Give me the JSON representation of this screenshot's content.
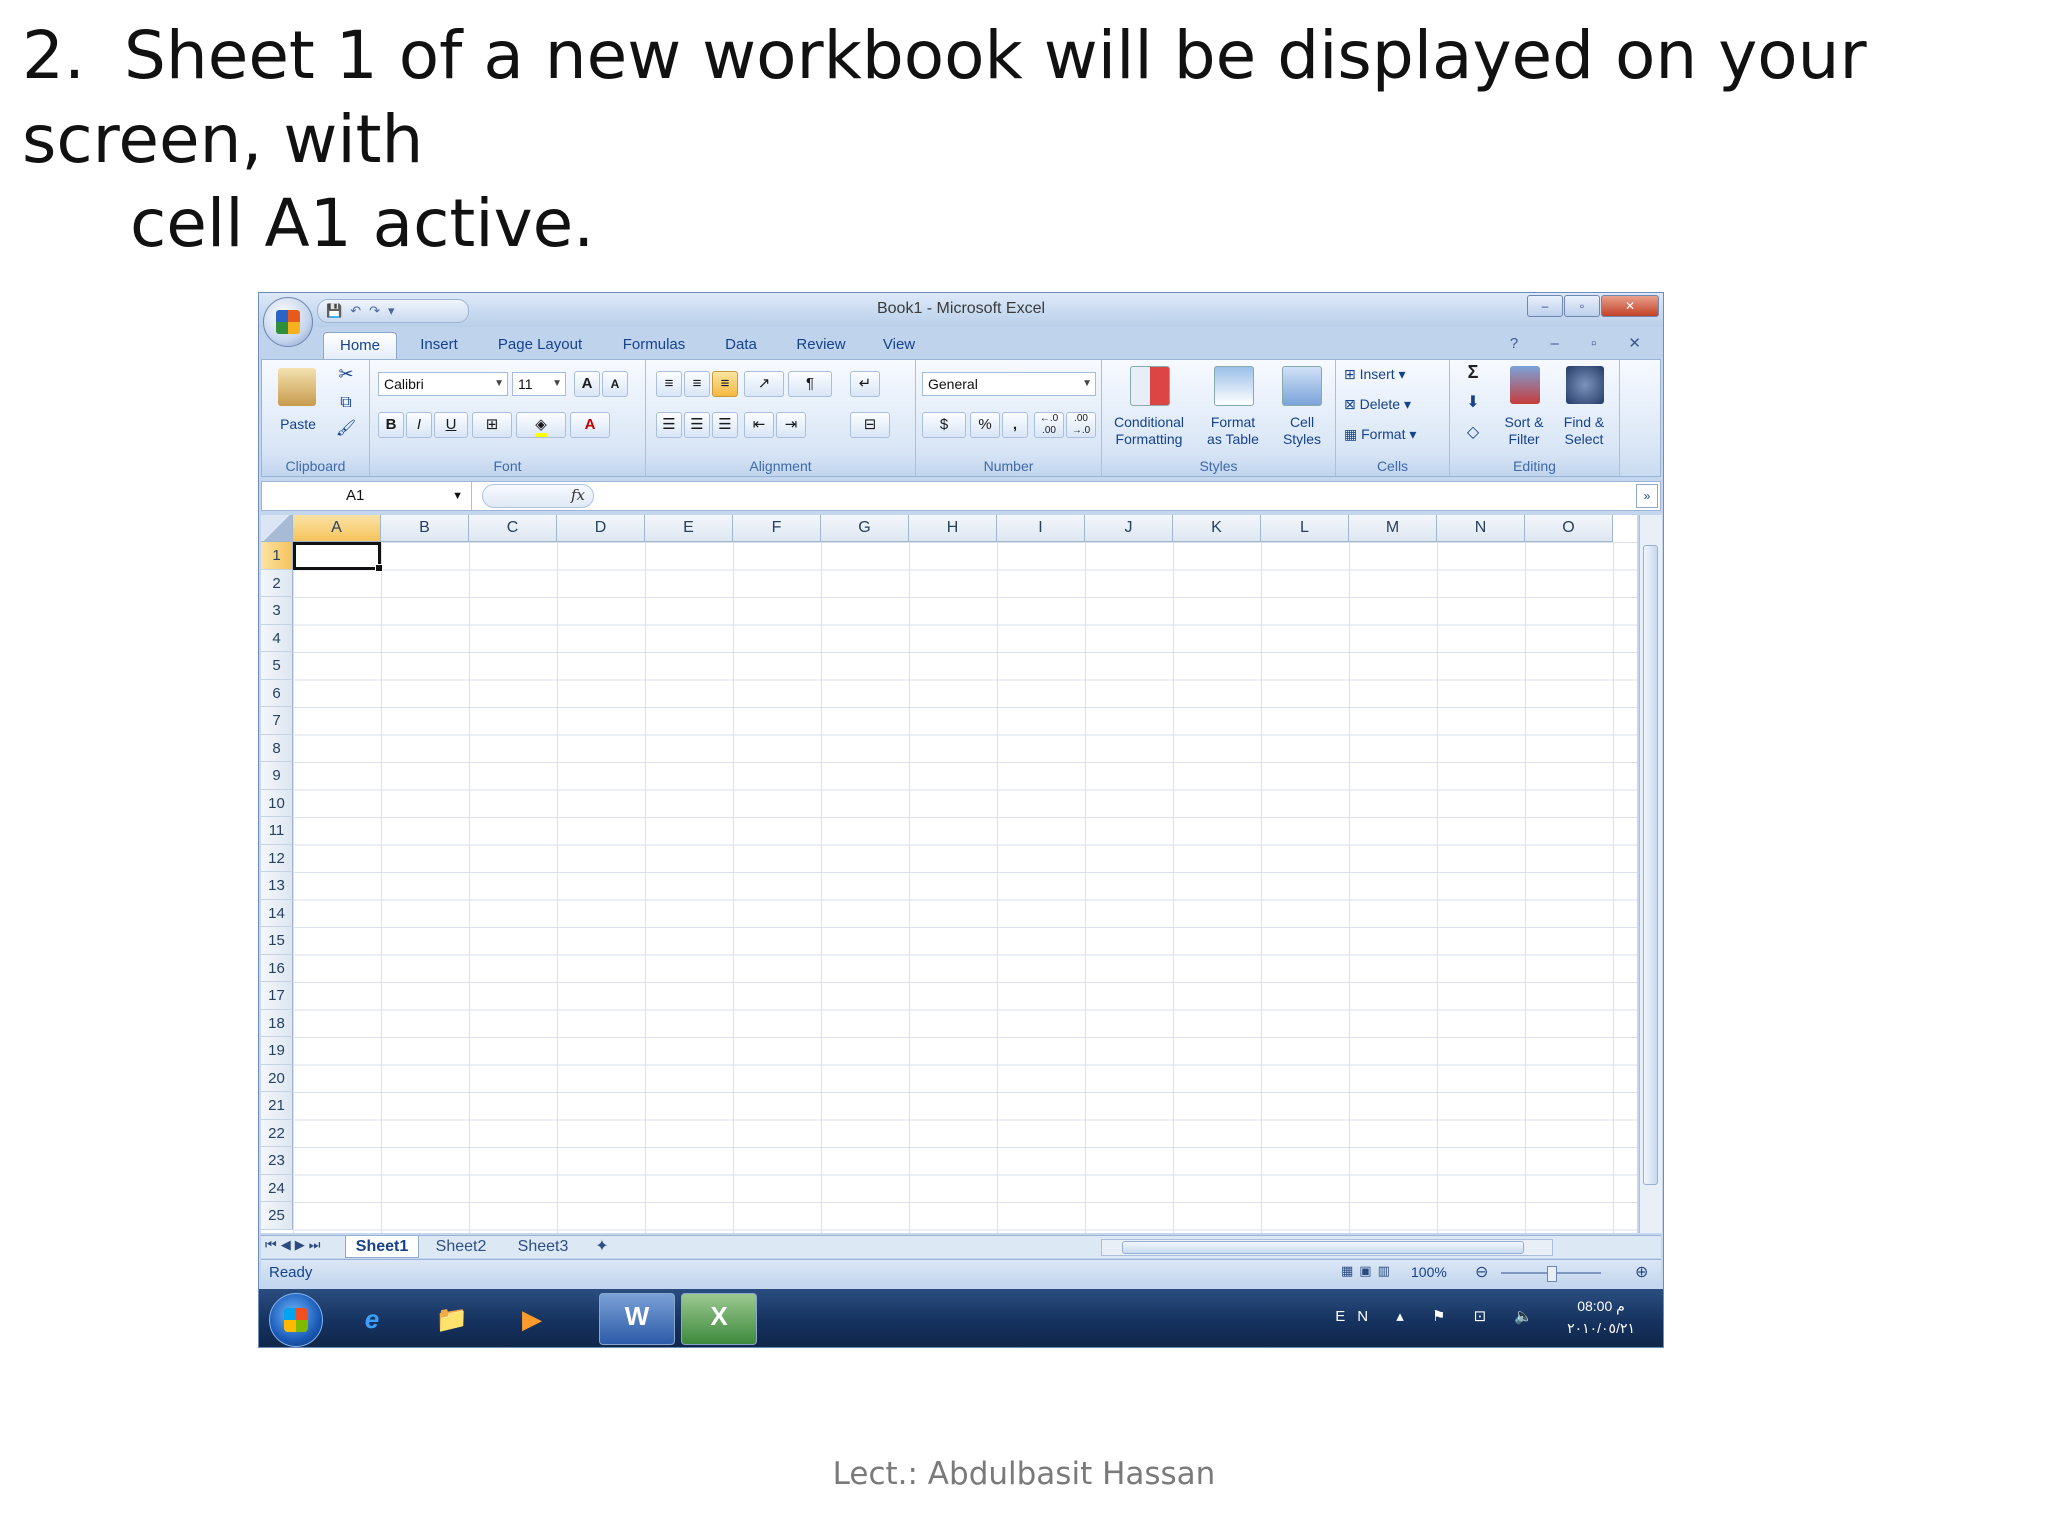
{
  "slide": {
    "number": "2.",
    "heading_line1": "Sheet 1 of a new workbook will be displayed on your screen, with",
    "heading_line2": "cell  A1 active.",
    "footer": "Lect.: Abdulbasit Hassan"
  },
  "window": {
    "title": "Book1 - Microsoft Excel",
    "controls": {
      "minimize": "–",
      "restore": "▫",
      "close": "✕"
    }
  },
  "ribbon_tabs": [
    "Home",
    "Insert",
    "Page Layout",
    "Formulas",
    "Data",
    "Review",
    "View"
  ],
  "active_tab": "Home",
  "help_controls": "? – ▫ ✕",
  "ribbon": {
    "clipboard": {
      "paste": "Paste",
      "group": "Clipboard"
    },
    "font": {
      "name": "Calibri",
      "size": "11",
      "bold": "B",
      "italic": "I",
      "underline": "U",
      "grow": "A",
      "shrink": "A",
      "color": "A",
      "group": "Font"
    },
    "alignment": {
      "group": "Alignment"
    },
    "number": {
      "format": "General",
      "percent": "%",
      "comma": ",",
      "inc_decimal": "←.0 .00",
      "dec_decimal": ".00 →.0",
      "group": "Number"
    },
    "styles": {
      "conditional": "Conditional",
      "conditional2": "Formatting",
      "format_table": "Format",
      "format_table2": "as Table",
      "cell_styles": "Cell",
      "cell_styles2": "Styles",
      "group": "Styles"
    },
    "cells": {
      "insert": "Insert",
      "delete": "Delete",
      "format": "Format",
      "group": "Cells"
    },
    "editing": {
      "sigma": "Σ",
      "sort": "Sort &",
      "sort2": "Filter",
      "find": "Find &",
      "find2": "Select",
      "group": "Editing"
    }
  },
  "formula_bar": {
    "name_box": "A1",
    "fx": "fx",
    "value": ""
  },
  "grid": {
    "columns": [
      "A",
      "B",
      "C",
      "D",
      "E",
      "F",
      "G",
      "H",
      "I",
      "J",
      "K",
      "L",
      "M",
      "N",
      "O"
    ],
    "rows": [
      "1",
      "2",
      "3",
      "4",
      "5",
      "6",
      "7",
      "8",
      "9",
      "10",
      "11",
      "12",
      "13",
      "14",
      "15",
      "16",
      "17",
      "18",
      "19",
      "20",
      "21",
      "22",
      "23",
      "24",
      "25"
    ],
    "active_cell": "A1"
  },
  "sheets": [
    "Sheet1",
    "Sheet2",
    "Sheet3"
  ],
  "active_sheet": "Sheet1",
  "status": {
    "text": "Ready",
    "zoom": "100%"
  },
  "taskbar": {
    "language": "EN",
    "time": "08:00 م",
    "date": "٢٠١٠/٠٥/٢١"
  }
}
